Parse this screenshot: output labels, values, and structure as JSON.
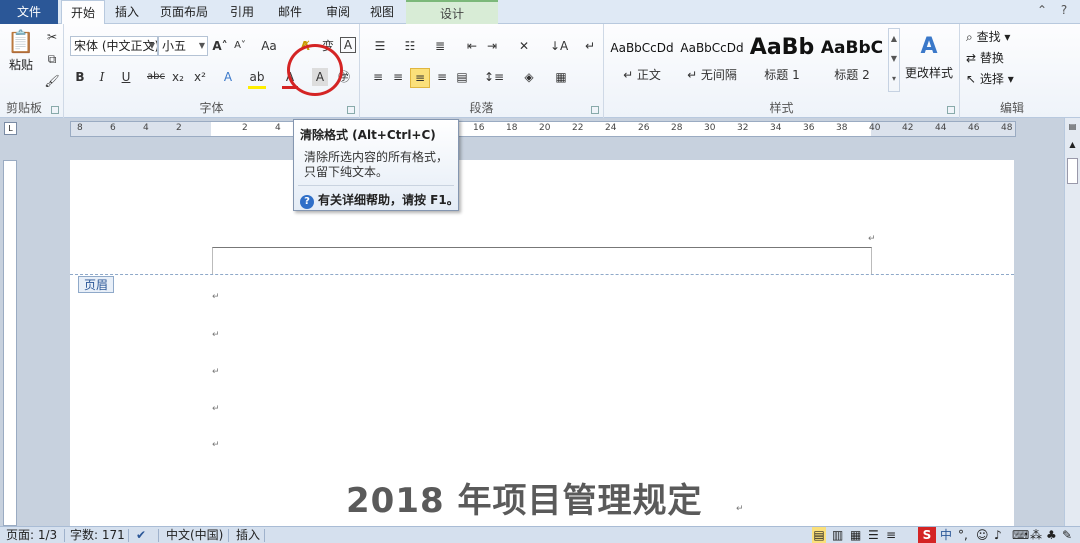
{
  "tabs": [
    {
      "label": "文件"
    },
    {
      "label": "开始"
    },
    {
      "label": "插入"
    },
    {
      "label": "页面布局"
    },
    {
      "label": "引用"
    },
    {
      "label": "邮件"
    },
    {
      "label": "审阅"
    },
    {
      "label": "视图"
    },
    {
      "label": "设计"
    }
  ],
  "clipboard": {
    "paste": "粘贴",
    "label": "剪贴板"
  },
  "font": {
    "family_value": "宋体 (中文正文)",
    "size_value": "小五",
    "label": "字体"
  },
  "paragraph": {
    "label": "段落"
  },
  "styles": {
    "label": "样式",
    "items": [
      {
        "sample": "AaBbCcDd",
        "name": "↵ 正文"
      },
      {
        "sample": "AaBbCcDd",
        "name": "↵ 无间隔"
      },
      {
        "sample": "AaBb",
        "name": "标题 1"
      },
      {
        "sample": "AaBbC",
        "name": "标题 2"
      }
    ],
    "change": "更改样式"
  },
  "editing": {
    "label": "编辑",
    "find": "查找",
    "replace": "替换",
    "select": "选择"
  },
  "tooltip": {
    "title": "清除格式 (Alt+Ctrl+C)",
    "body": "清除所选内容的所有格式，只留下纯文本。",
    "help": "有关详细帮助，请按 F1。"
  },
  "document": {
    "header_tag": "页眉",
    "title": "2018 年项目管理规定"
  },
  "ruler_numbers": [
    "8",
    "6",
    "4",
    "2",
    "",
    "2",
    "4",
    "6",
    "8",
    "10",
    "12",
    "14",
    "16",
    "18",
    "20",
    "22",
    "24",
    "26",
    "28",
    "30",
    "32",
    "34",
    "36",
    "38",
    "40",
    "42",
    "44",
    "46",
    "48"
  ],
  "status": {
    "page": "页面: 1/3",
    "words": "字数: 171",
    "language": "中文(中国)",
    "mode": "插入"
  }
}
